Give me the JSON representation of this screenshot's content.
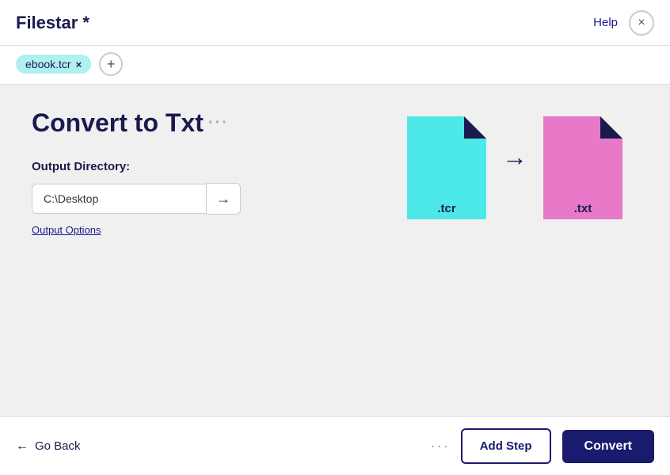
{
  "app": {
    "title": "Filestar *",
    "help_label": "Help",
    "close_label": "×"
  },
  "tabs": {
    "file_tab_label": "ebook.tcr",
    "file_tab_close": "×",
    "add_tab_label": "+"
  },
  "main": {
    "page_title": "Convert to Txt",
    "title_dots": "···",
    "output_label": "Output Directory:",
    "output_value": "C:\\Desktop",
    "output_arrow": "→",
    "output_options_label": "Output Options"
  },
  "graphic": {
    "source_label": ".tcr",
    "target_label": ".txt",
    "arrow": "→"
  },
  "footer": {
    "go_back_label": "Go Back",
    "back_arrow": "←",
    "more_dots": "···",
    "add_step_label": "Add Step",
    "convert_label": "Convert"
  },
  "colors": {
    "dark_navy": "#1a1a6e",
    "cyan": "#4de8e8",
    "pink": "#e878c8",
    "corner_navy": "#1a1a4e"
  }
}
